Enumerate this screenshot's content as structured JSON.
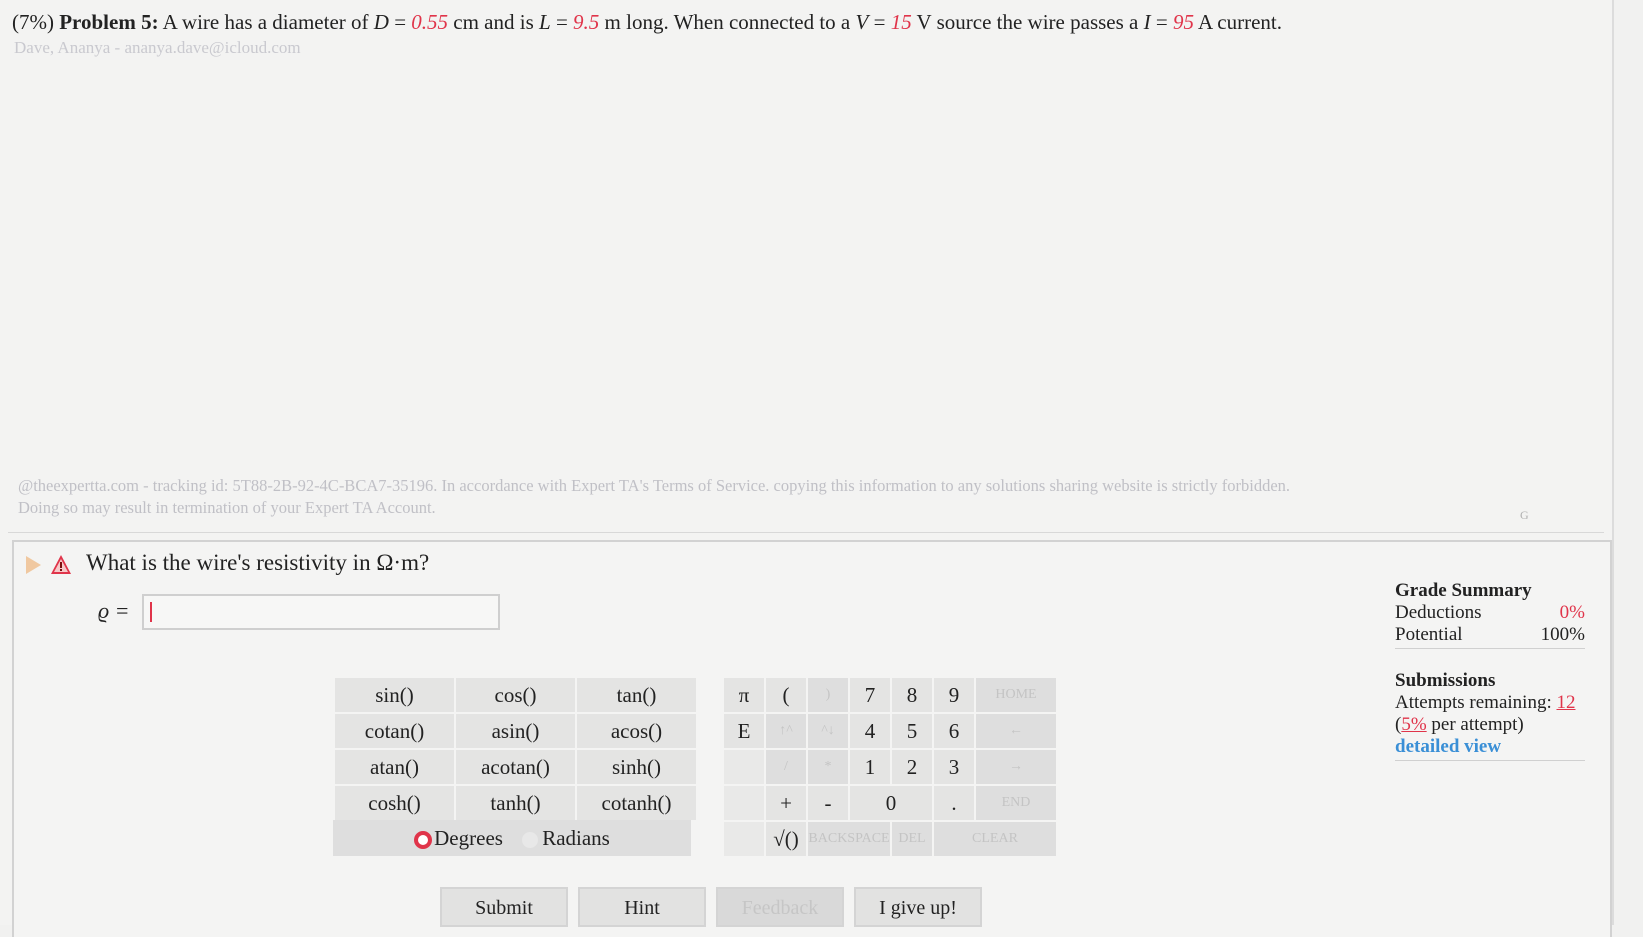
{
  "problem": {
    "weight": "(7%)",
    "label": "Problem 5:",
    "t1": "A wire has a diameter of ",
    "var_d": "D",
    "eq": " = ",
    "d_val": "0.55",
    "t2": " cm and is ",
    "var_l": "L",
    "l_val": "9.5",
    "t3": " m long. When connected to a ",
    "var_v": "V",
    "v_val": "15",
    "t4": " V source the wire passes a ",
    "var_i": "I",
    "i_val": "95",
    "t5": " A current."
  },
  "student": "Dave, Ananya - ananya.dave@icloud.com",
  "tracking": {
    "line1": "@theexpertta.com - tracking id: 5T88-2B-92-4C-BCA7-35196. In accordance with Expert TA's Terms of Service. copying this information to any solutions sharing website is strictly forbidden.",
    "line2": "Doing so may result in termination of your Expert TA Account.",
    "tiny": "G"
  },
  "question": {
    "text": "What is the wire's resistivity in Ω·m?",
    "var_label": "ϱ =",
    "input_value": ""
  },
  "calculator": {
    "functions": [
      [
        "sin()",
        "cos()",
        "tan()"
      ],
      [
        "cotan()",
        "asin()",
        "acos()"
      ],
      [
        "atan()",
        "acotan()",
        "sinh()"
      ],
      [
        "cosh()",
        "tanh()",
        "cotanh()"
      ]
    ],
    "mode_degrees": "Degrees",
    "mode_radians": "Radians",
    "pi": "π",
    "e": "E",
    "lparen": "(",
    "rparen": ")",
    "up": "↑^",
    "down": "^↓",
    "slash": "/",
    "star": "*",
    "plus": "+",
    "minus": "-",
    "sqrt": "√()",
    "digits": [
      "7",
      "8",
      "9",
      "4",
      "5",
      "6",
      "1",
      "2",
      "3",
      "0"
    ],
    "dot": ".",
    "home": "HOME",
    "left": "←",
    "right": "→",
    "end": "END",
    "backspace": "BACKSPACE",
    "del": "DEL",
    "clear": "CLEAR"
  },
  "actions": {
    "submit": "Submit",
    "hint": "Hint",
    "feedback": "Feedback",
    "give_up": "I give up!"
  },
  "grade_summary": {
    "title": "Grade Summary",
    "deductions_label": "Deductions",
    "deductions_value": "0%",
    "potential_label": "Potential",
    "potential_value": "100%"
  },
  "submissions": {
    "title": "Submissions",
    "attempts_label": "Attempts remaining: ",
    "attempts_value": "12",
    "per_open": "(",
    "per_value": "5%",
    "per_text": " per attempt)",
    "detail_link": "detailed view"
  },
  "colors": {
    "accent_red": "#e0344a",
    "link_blue": "#3a8fd6"
  }
}
